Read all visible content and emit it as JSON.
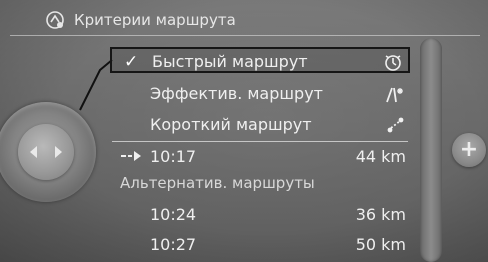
{
  "header": {
    "title": "Критерии маршрута",
    "icon": "route-settings-icon"
  },
  "menu": {
    "items": [
      {
        "label": "Быстрый маршрут",
        "selected": true,
        "checked": true,
        "icon": "stopwatch-icon"
      },
      {
        "label": "Эффектив. маршрут",
        "selected": false,
        "checked": false,
        "icon": "road-sparkle-icon"
      },
      {
        "label": "Короткий маршрут",
        "selected": false,
        "checked": false,
        "icon": "short-route-icon"
      }
    ],
    "current_route": {
      "time": "10:17",
      "distance": "44 km",
      "icon": "route-arrow-icon"
    },
    "alternatives_label": "Альтернатив. маршруты",
    "alternatives": [
      {
        "time": "10:24",
        "distance": "36 km"
      },
      {
        "time": "10:27",
        "distance": "50 km"
      }
    ]
  },
  "controls": {
    "left_knob": "controller-knob",
    "right_button_symbol": "+"
  },
  "colors": {
    "background": "#6c6c6c",
    "text": "#efefef",
    "selection_border": "#161616"
  }
}
